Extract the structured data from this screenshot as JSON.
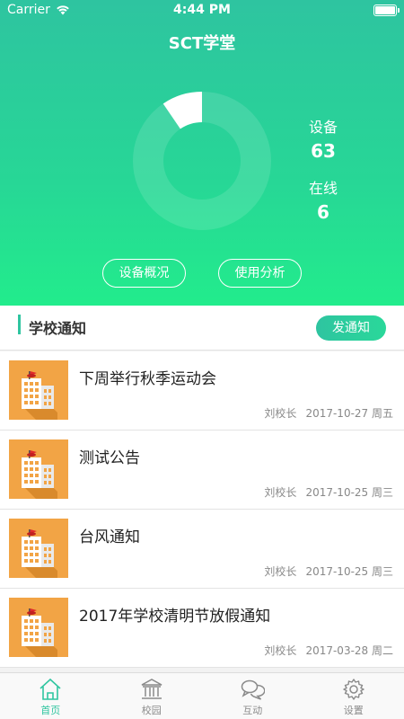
{
  "status_bar": {
    "carrier": "Carrier",
    "time": "4:44 PM"
  },
  "app": {
    "title": "SCT学堂"
  },
  "summary": {
    "devices_label": "设备",
    "devices_count": "63",
    "online_label": "在线",
    "online_count": "6",
    "online_fraction": 0.095
  },
  "actions": {
    "overview_label": "设备概况",
    "analysis_label": "使用分析"
  },
  "notices": {
    "header_title": "学校通知",
    "send_label": "发通知",
    "items": [
      {
        "title": "下周举行秋季运动会",
        "author": "刘校长",
        "date": "2017-10-27 周五"
      },
      {
        "title": "测试公告",
        "author": "刘校长",
        "date": "2017-10-25 周三"
      },
      {
        "title": "台风通知",
        "author": "刘校长",
        "date": "2017-10-25 周三"
      },
      {
        "title": "2017年学校清明节放假通知",
        "author": "刘校长",
        "date": "2017-03-28 周二"
      }
    ]
  },
  "tabs": [
    {
      "label": "首页",
      "icon": "home-icon",
      "active": true
    },
    {
      "label": "校园",
      "icon": "campus-building-icon",
      "active": false
    },
    {
      "label": "互动",
      "icon": "chat-bubbles-icon",
      "active": false
    },
    {
      "label": "设置",
      "icon": "gear-icon",
      "active": false
    }
  ],
  "colors": {
    "accent": "#2fc5a0",
    "hero_top": "#2ec4a0",
    "hero_bottom": "#22ec8c",
    "thumb": "#f2a445"
  }
}
